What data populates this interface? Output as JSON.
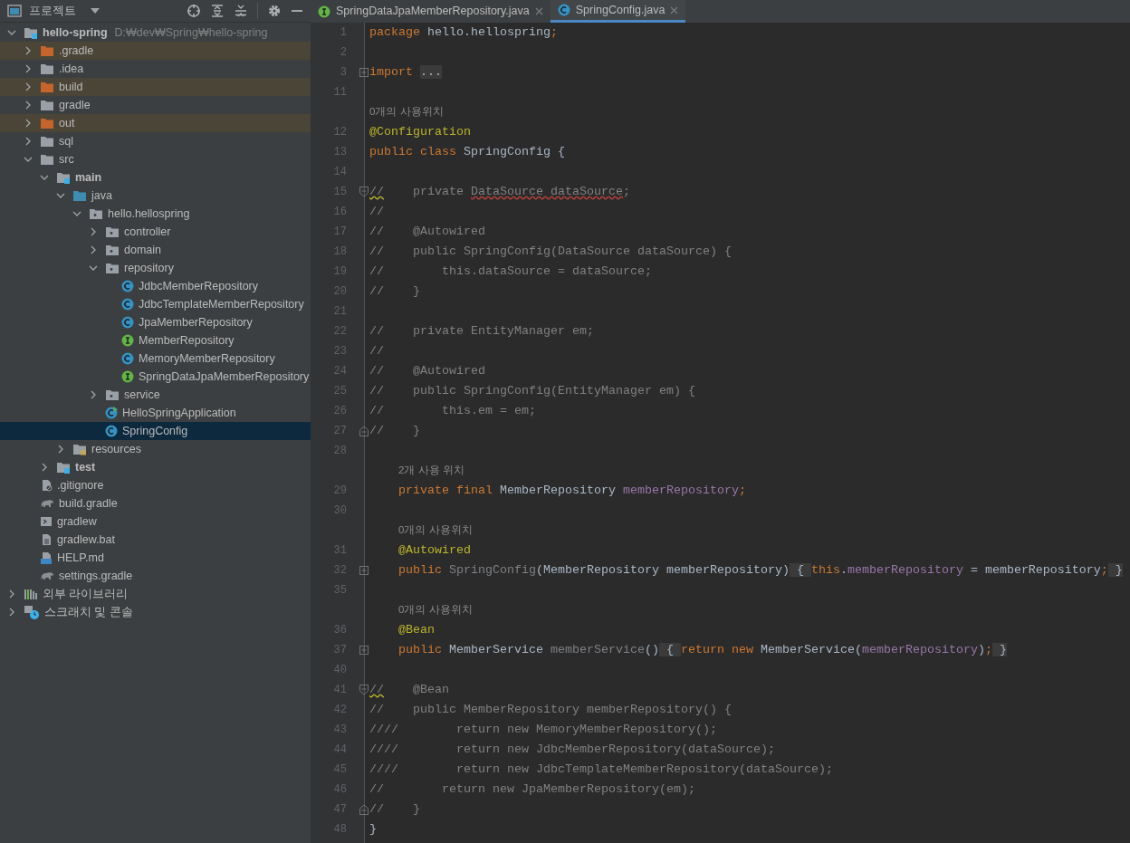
{
  "project_panel": {
    "title": "프로젝트"
  },
  "tree": [
    {
      "label": "hello-spring",
      "path": "D:₩dev₩Spring₩hello-spring",
      "kind": "module",
      "expanded": true,
      "selected": false,
      "children": [
        {
          "label": ".gradle",
          "kind": "excluded-folder",
          "expanded": false,
          "selected": false
        },
        {
          "label": ".idea",
          "kind": "folder",
          "expanded": false,
          "selected": false
        },
        {
          "label": "build",
          "kind": "excluded-folder",
          "expanded": false,
          "selected": false
        },
        {
          "label": "gradle",
          "kind": "folder",
          "expanded": false,
          "selected": false
        },
        {
          "label": "out",
          "kind": "excluded-folder",
          "expanded": false,
          "selected": false
        },
        {
          "label": "sql",
          "kind": "folder",
          "expanded": false,
          "selected": false
        },
        {
          "label": "src",
          "kind": "folder",
          "expanded": true,
          "selected": false,
          "children": [
            {
              "label": "main",
              "kind": "module",
              "expanded": true,
              "selected": false,
              "children": [
                {
                  "label": "java",
                  "kind": "source-folder",
                  "expanded": true,
                  "selected": false,
                  "children": [
                    {
                      "label": "hello.hellospring",
                      "kind": "package",
                      "expanded": true,
                      "selected": false,
                      "children": [
                        {
                          "label": "controller",
                          "kind": "package",
                          "expanded": false,
                          "selected": false
                        },
                        {
                          "label": "domain",
                          "kind": "package",
                          "expanded": false,
                          "selected": false
                        },
                        {
                          "label": "repository",
                          "kind": "package",
                          "expanded": true,
                          "selected": false,
                          "children": [
                            {
                              "label": "JdbcMemberRepository",
                              "kind": "class",
                              "selected": false
                            },
                            {
                              "label": "JdbcTemplateMemberRepository",
                              "kind": "class",
                              "selected": false
                            },
                            {
                              "label": "JpaMemberRepository",
                              "kind": "class",
                              "selected": false
                            },
                            {
                              "label": "MemberRepository",
                              "kind": "interface",
                              "selected": false
                            },
                            {
                              "label": "MemoryMemberRepository",
                              "kind": "class",
                              "selected": false
                            },
                            {
                              "label": "SpringDataJpaMemberRepository",
                              "kind": "interface",
                              "selected": false
                            }
                          ]
                        },
                        {
                          "label": "service",
                          "kind": "package",
                          "expanded": false,
                          "selected": false
                        },
                        {
                          "label": "HelloSpringApplication",
                          "kind": "app-class",
                          "selected": false
                        },
                        {
                          "label": "SpringConfig",
                          "kind": "class",
                          "selected": true
                        }
                      ]
                    }
                  ]
                },
                {
                  "label": "resources",
                  "kind": "resources-folder",
                  "expanded": false,
                  "selected": false
                }
              ]
            },
            {
              "label": "test",
              "kind": "module",
              "expanded": false,
              "selected": false
            }
          ]
        },
        {
          "label": ".gitignore",
          "kind": "ignore-file",
          "selected": false
        },
        {
          "label": "build.gradle",
          "kind": "gradle-file",
          "selected": false
        },
        {
          "label": "gradlew",
          "kind": "shell-file",
          "selected": false
        },
        {
          "label": "gradlew.bat",
          "kind": "text-file",
          "selected": false
        },
        {
          "label": "HELP.md",
          "kind": "markdown-file",
          "selected": false
        },
        {
          "label": "settings.gradle",
          "kind": "gradle-file",
          "selected": false
        }
      ]
    },
    {
      "label": "외부 라이브러리",
      "kind": "libraries",
      "expanded": false,
      "selected": false
    },
    {
      "label": "스크래치 및 콘솔",
      "kind": "scratches",
      "expanded": false,
      "selected": false
    }
  ],
  "tabs": [
    {
      "label": "SpringDataJpaMemberRepository.java",
      "kind": "interface",
      "selected": false
    },
    {
      "label": "SpringConfig.java",
      "kind": "class",
      "selected": true
    }
  ],
  "lines": [
    {
      "kind": "code",
      "number": "1",
      "tokens": [
        {
          "kind": "kw",
          "text": "package"
        },
        {
          "kind": "plain",
          "text": " hello.hellospring"
        },
        {
          "kind": "kw",
          "text": ";"
        }
      ]
    },
    {
      "kind": "code",
      "number": "2"
    },
    {
      "kind": "code",
      "number": "3",
      "fold": {
        "kind": "expand"
      },
      "tokens": [
        {
          "kind": "kw",
          "text": "import "
        },
        {
          "kind": "folded",
          "text": "..."
        }
      ]
    },
    {
      "kind": "code",
      "number": "11"
    },
    {
      "kind": "hint",
      "text": "0개의 사용위치"
    },
    {
      "kind": "code",
      "number": "12",
      "tokens": [
        {
          "kind": "ann",
          "text": "@Configuration"
        }
      ]
    },
    {
      "kind": "code",
      "number": "13",
      "tokens": [
        {
          "kind": "kw",
          "text": "public class"
        },
        {
          "kind": "plain",
          "text": " SpringConfig {"
        }
      ]
    },
    {
      "kind": "code",
      "number": "14"
    },
    {
      "kind": "code",
      "number": "15",
      "fold": {
        "kind": "start"
      },
      "tokens": [
        {
          "kind": "cwarn",
          "text": "//"
        },
        {
          "kind": "comment",
          "text": "    private "
        },
        {
          "kind": "cerr",
          "text": "DataSource dataSource"
        },
        {
          "kind": "comment",
          "text": ";"
        }
      ]
    },
    {
      "kind": "code",
      "number": "16",
      "tokens": [
        {
          "kind": "comment",
          "text": "//"
        }
      ]
    },
    {
      "kind": "code",
      "number": "17",
      "tokens": [
        {
          "kind": "comment",
          "text": "//    @Autowired"
        }
      ]
    },
    {
      "kind": "code",
      "number": "18",
      "tokens": [
        {
          "kind": "comment",
          "text": "//    public SpringConfig(DataSource dataSource) {"
        }
      ]
    },
    {
      "kind": "code",
      "number": "19",
      "tokens": [
        {
          "kind": "comment",
          "text": "//        this.dataSource = dataSource;"
        }
      ]
    },
    {
      "kind": "code",
      "number": "20",
      "tokens": [
        {
          "kind": "comment",
          "text": "//    }"
        }
      ]
    },
    {
      "kind": "code",
      "number": "21"
    },
    {
      "kind": "code",
      "number": "22",
      "tokens": [
        {
          "kind": "comment",
          "text": "//    private EntityManager em;"
        }
      ]
    },
    {
      "kind": "code",
      "number": "23",
      "tokens": [
        {
          "kind": "comment",
          "text": "//"
        }
      ]
    },
    {
      "kind": "code",
      "number": "24",
      "tokens": [
        {
          "kind": "comment",
          "text": "//    @Autowired"
        }
      ]
    },
    {
      "kind": "code",
      "number": "25",
      "tokens": [
        {
          "kind": "comment",
          "text": "//    public SpringConfig(EntityManager em) {"
        }
      ]
    },
    {
      "kind": "code",
      "number": "26",
      "tokens": [
        {
          "kind": "comment",
          "text": "//        this.em = em;"
        }
      ]
    },
    {
      "kind": "code",
      "number": "27",
      "fold": {
        "kind": "end"
      },
      "tokens": [
        {
          "kind": "comment",
          "text": "//    }"
        }
      ]
    },
    {
      "kind": "code",
      "number": "28"
    },
    {
      "kind": "hint",
      "text": "2개 사용 위치"
    },
    {
      "kind": "code",
      "number": "29",
      "tokens": [
        {
          "kind": "kw",
          "text": "    private final"
        },
        {
          "kind": "plain",
          "text": " MemberRepository "
        },
        {
          "kind": "field",
          "text": "memberRepository"
        },
        {
          "kind": "kw",
          "text": ";"
        }
      ]
    },
    {
      "kind": "code",
      "number": "30"
    },
    {
      "kind": "hint",
      "text": "0개의 사용위치"
    },
    {
      "kind": "code",
      "number": "31",
      "tokens": [
        {
          "kind": "ann",
          "text": "    @Autowired"
        }
      ]
    },
    {
      "kind": "code",
      "number": "32",
      "fold": {
        "kind": "expand"
      },
      "tokens": [
        {
          "kind": "kw",
          "text": "    public "
        },
        {
          "kind": "unused",
          "text": "SpringConfig"
        },
        {
          "kind": "plain",
          "text": "(MemberRepository memberRepository)"
        },
        {
          "kind": "folded",
          "text": " { "
        },
        {
          "kind": "kw",
          "text": "this"
        },
        {
          "kind": "plain",
          "text": "."
        },
        {
          "kind": "field",
          "text": "memberRepository"
        },
        {
          "kind": "plain",
          "text": " = memberRepository"
        },
        {
          "kind": "kw",
          "text": ";"
        },
        {
          "kind": "folded",
          "text": " }"
        }
      ]
    },
    {
      "kind": "code",
      "number": "35"
    },
    {
      "kind": "hint",
      "text": "0개의 사용위치"
    },
    {
      "kind": "code",
      "number": "36",
      "tokens": [
        {
          "kind": "ann",
          "text": "    @Bean"
        }
      ]
    },
    {
      "kind": "code",
      "number": "37",
      "fold": {
        "kind": "expand"
      },
      "tokens": [
        {
          "kind": "kw",
          "text": "    public"
        },
        {
          "kind": "plain",
          "text": " MemberService "
        },
        {
          "kind": "unused",
          "text": "memberService"
        },
        {
          "kind": "plain",
          "text": "()"
        },
        {
          "kind": "folded",
          "text": " { "
        },
        {
          "kind": "kw",
          "text": "return new"
        },
        {
          "kind": "plain",
          "text": " MemberService("
        },
        {
          "kind": "field",
          "text": "memberRepository"
        },
        {
          "kind": "plain",
          "text": ")"
        },
        {
          "kind": "kw",
          "text": ";"
        },
        {
          "kind": "folded",
          "text": " }"
        }
      ]
    },
    {
      "kind": "code",
      "number": "40"
    },
    {
      "kind": "code",
      "number": "41",
      "fold": {
        "kind": "start"
      },
      "tokens": [
        {
          "kind": "cwarn",
          "text": "//"
        },
        {
          "kind": "comment",
          "text": "    @Bean"
        }
      ]
    },
    {
      "kind": "code",
      "number": "42",
      "tokens": [
        {
          "kind": "comment",
          "text": "//    public MemberRepository memberRepository() {"
        }
      ]
    },
    {
      "kind": "code",
      "number": "43",
      "tokens": [
        {
          "kind": "comment",
          "text": "////        return new MemoryMemberRepository();"
        }
      ]
    },
    {
      "kind": "code",
      "number": "44",
      "tokens": [
        {
          "kind": "comment",
          "text": "////        return new JdbcMemberRepository(dataSource);"
        }
      ]
    },
    {
      "kind": "code",
      "number": "45",
      "tokens": [
        {
          "kind": "comment",
          "text": "////        return new JdbcTemplateMemberRepository(dataSource);"
        }
      ]
    },
    {
      "kind": "code",
      "number": "46",
      "tokens": [
        {
          "kind": "comment",
          "text": "//        return new JpaMemberRepository(em);"
        }
      ]
    },
    {
      "kind": "code",
      "number": "47",
      "fold": {
        "kind": "end"
      },
      "tokens": [
        {
          "kind": "comment",
          "text": "//    }"
        }
      ]
    },
    {
      "kind": "code",
      "number": "48",
      "tokens": [
        {
          "kind": "plain",
          "text": "}"
        }
      ]
    }
  ]
}
